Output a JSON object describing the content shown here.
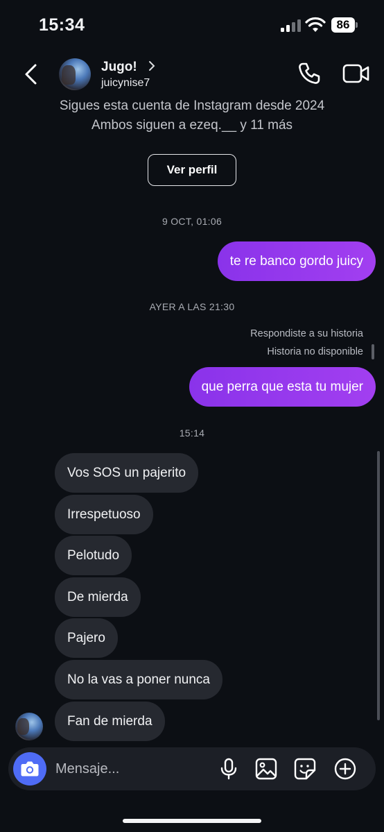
{
  "status_bar": {
    "time": "15:34",
    "battery": "86"
  },
  "header": {
    "name": "Jugo!",
    "handle": "juicynise7"
  },
  "profile_info": {
    "line1": "Sigues esta cuenta de Instagram desde 2024",
    "line2": "Ambos siguen a ezeq.__ y 11 más",
    "button": "Ver perfil"
  },
  "messages": {
    "ts1": "9 OCT, 01:06",
    "out1": "te re banco gordo juicy",
    "ts2": "AYER A LAS 21:30",
    "reply_note": "Respondiste a su historia",
    "story_unavailable": "Historia no disponible",
    "out2": "que perra que esta tu mujer",
    "ts3": "15:14",
    "incoming": [
      "Vos SOS un pajerito",
      "Irrespetuoso",
      "Pelotudo",
      "De mierda",
      "Pajero",
      "No la vas a poner nunca",
      "Fan de mierda"
    ]
  },
  "composer": {
    "placeholder": "Mensaje..."
  },
  "colors": {
    "background": "#0c0f14",
    "outgoing_bubble": "#9b3cee",
    "incoming_bubble": "#262930",
    "camera_button": "#4f6cf6"
  },
  "icons": [
    "back-icon",
    "chevron-right-icon",
    "phone-icon",
    "video-icon",
    "camera-icon",
    "microphone-icon",
    "image-icon",
    "sticker-icon",
    "plus-icon"
  ]
}
